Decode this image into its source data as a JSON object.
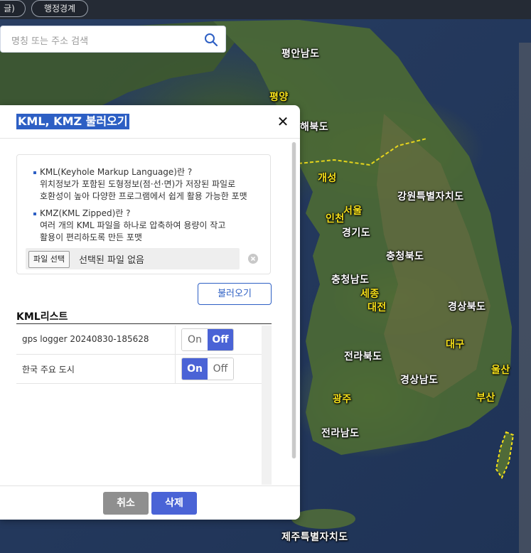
{
  "top_bar": {
    "pill_left_label": "글)",
    "pill_admin_label": "행정경계"
  },
  "search": {
    "placeholder": "명칭 또는 주소 검색",
    "icon": "search-icon"
  },
  "map": {
    "regions": [
      {
        "name": "평안남도",
        "type": "province"
      },
      {
        "name": "평양",
        "type": "city"
      },
      {
        "name": "해북도",
        "type": "province"
      },
      {
        "name": "개성",
        "type": "city"
      },
      {
        "name": "강원특별자치도",
        "type": "province"
      },
      {
        "name": "인천",
        "type": "city"
      },
      {
        "name": "서울",
        "type": "city"
      },
      {
        "name": "경기도",
        "type": "province"
      },
      {
        "name": "충청북도",
        "type": "province"
      },
      {
        "name": "충청남도",
        "type": "province"
      },
      {
        "name": "세종",
        "type": "city"
      },
      {
        "name": "대전",
        "type": "city"
      },
      {
        "name": "경상북도",
        "type": "province"
      },
      {
        "name": "대구",
        "type": "city"
      },
      {
        "name": "전라북도",
        "type": "province"
      },
      {
        "name": "울산",
        "type": "city"
      },
      {
        "name": "경상남도",
        "type": "province"
      },
      {
        "name": "광주",
        "type": "city"
      },
      {
        "name": "부산",
        "type": "city"
      },
      {
        "name": "전라남도",
        "type": "province"
      },
      {
        "name": "제주특별자치도",
        "type": "province"
      }
    ],
    "colors": {
      "city_label": "#f6e11a",
      "province_label": "#ffffff",
      "boundary": "#f6e11a"
    }
  },
  "dialog": {
    "title": "KML, KMZ 불러오기",
    "close_icon": "close-icon",
    "info": {
      "kml_title": "KML(Keyhole Markup Language)란 ?",
      "kml_line1": "위치정보가 포함된 도형정보(점·선·면)가 저장된 파일로",
      "kml_line2": "호환성이 높아 다양한 프로그램에서 쉽게 활용 가능한 포맷",
      "kmz_title": "KMZ(KML Zipped)란 ?",
      "kmz_line1": "여러 개의 KML 파일을 하나로 압축하여 용량이 작고",
      "kmz_line2": "활용이 편리하도록 만든 포맷"
    },
    "file": {
      "button_label": "파일 선택",
      "status": "선택된 파일 없음"
    },
    "load_button": "불러오기",
    "list_heading": "KML리스트",
    "kml_items": [
      {
        "name": "gps logger 20240830-185628",
        "on_label": "On",
        "off_label": "Off",
        "state": "off"
      },
      {
        "name": "한국 주요 도시",
        "on_label": "On",
        "off_label": "Off",
        "state": "on"
      }
    ],
    "footer": {
      "cancel_label": "취소",
      "delete_label": "삭제"
    },
    "colors": {
      "accent": "#4a63d6",
      "title_highlight": "#2d5fc4",
      "cancel": "#8f8f8f"
    }
  }
}
